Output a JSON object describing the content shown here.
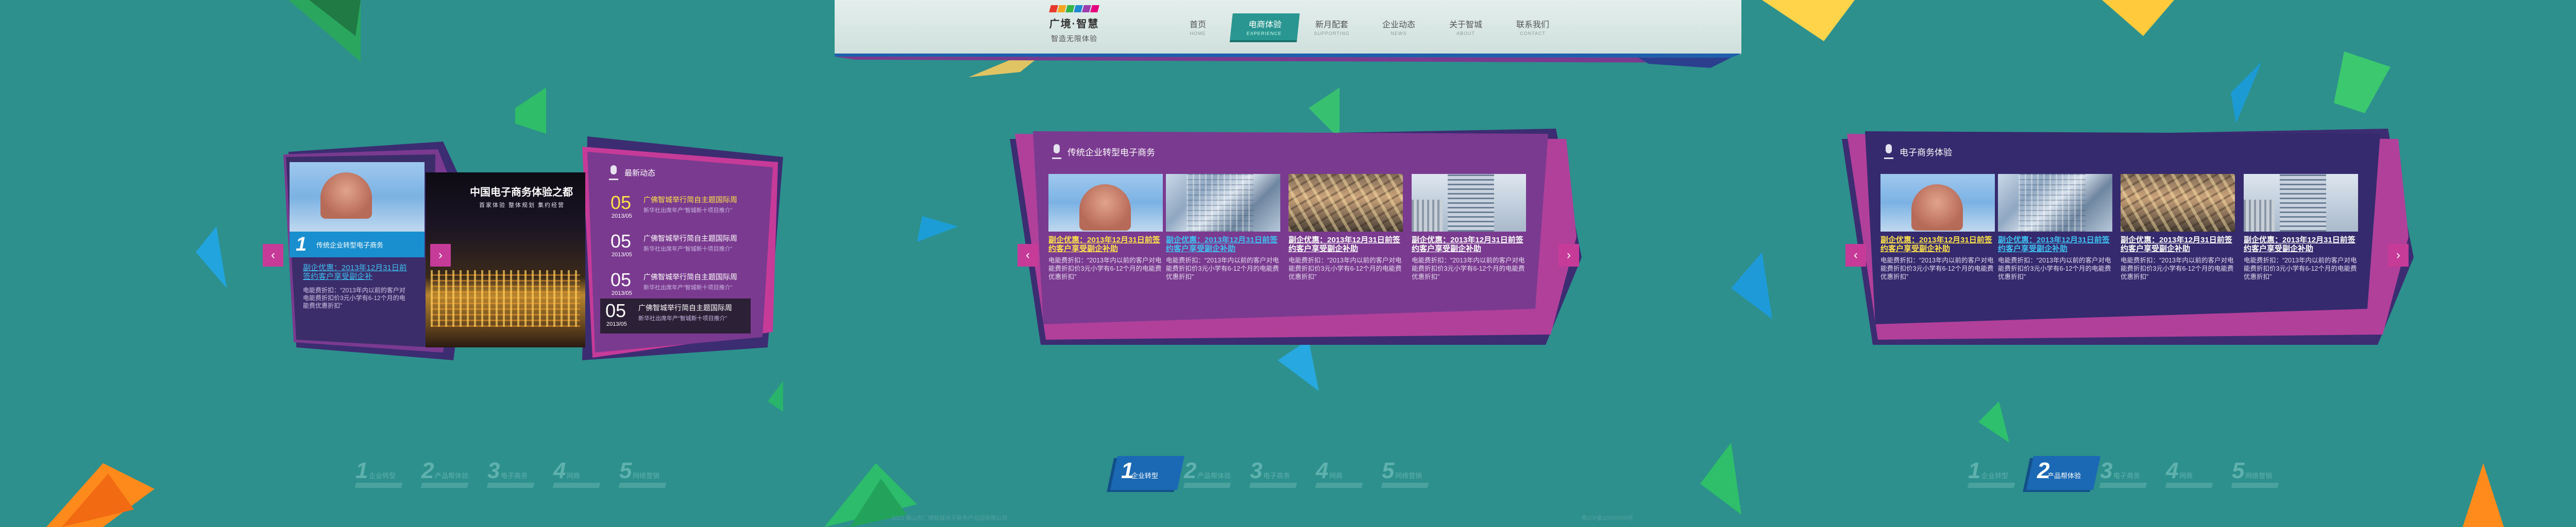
{
  "colors": {
    "background": "#2e908c",
    "purple": "#7a3a8f",
    "purple_dark": "#3a2d6a",
    "magenta": "#c63b98",
    "nav_active": "#2a9691",
    "step_active": "#1b69b4",
    "highlight_text": "#ffe24a"
  },
  "header": {
    "logo_title": "广境·智慧",
    "logo_sub": "智造无限体验",
    "nav": [
      {
        "zh": "首页",
        "en": "HOME"
      },
      {
        "zh": "电商体验",
        "en": "EXPERIENCE"
      },
      {
        "zh": "新月配套",
        "en": "SUPPORTING"
      },
      {
        "zh": "企业动态",
        "en": "NEWS"
      },
      {
        "zh": "关于智城",
        "en": "ABOUT"
      },
      {
        "zh": "联系我们",
        "en": "CONTACT"
      }
    ],
    "active_nav": 1
  },
  "left_panel": {
    "feature_number": "1",
    "feature_label": "传统企业转型电子商务",
    "feature_link": "副企优惠：2013年12月31日前签约客户享受副企补",
    "feature_text": "电能费折扣：“2013年内以前的客户对电能费折扣价3元小学有6-12个月的电能费优惠折扣”",
    "big_title": "中国电子商务体验之都",
    "big_sub": "首家体验 整体规划 集约经营",
    "news_heading": "最新动态",
    "news": [
      {
        "day": "05",
        "ym": "2013/05",
        "title": "广佛智城举行简自主题国际周",
        "sub": "新华社出席年产“智城新十项目推介”"
      },
      {
        "day": "05",
        "ym": "2013/05",
        "title": "广佛智城举行简自主题国际周",
        "sub": "新华社出席年产“智城新十项目推介”"
      },
      {
        "day": "05",
        "ym": "2013/05",
        "title": "广佛智城举行简自主题国际周",
        "sub": "新华社出席年产“智城新十项目推介”"
      },
      {
        "day": "05",
        "ym": "2013/05",
        "title": "广佛智城举行简自主题国际周",
        "sub": "新华社出席年产“智城新十项目推介”"
      }
    ]
  },
  "middle_panel": {
    "title": "传统企业转型电子商务",
    "cards": [
      {
        "title": "副企优惠：2013年12月31日前签约客户享受副企补助",
        "body": "电能费折扣：“2013年内以前的客户对电能费折扣价3元小学有6-12个月的电能费优惠折扣”"
      },
      {
        "title": "副企优惠：2013年12月31日前签约客户享受副企补助",
        "body": "电能费折扣：“2013年内以前的客户对电能费折扣价3元小学有6-12个月的电能费优惠折扣”"
      },
      {
        "title": "副企优惠：2013年12月31日前签约客户享受副企补助",
        "body": "电能费折扣：“2013年内以前的客户对电能费折扣价3元小学有6-12个月的电能费优惠折扣”"
      },
      {
        "title": "副企优惠：2013年12月31日前签约客户享受副企补助",
        "body": "电能费折扣：“2013年内以前的客户对电能费折扣价3元小学有6-12个月的电能费优惠折扣”"
      }
    ]
  },
  "right_panel": {
    "title": "电子商务体验",
    "cards": [
      {
        "title": "副企优惠：2013年12月31日前签约客户享受副企补助",
        "body": "电能费折扣：“2013年内以前的客户对电能费折扣价3元小学有6-12个月的电能费优惠折扣”"
      },
      {
        "title": "副企优惠：2013年12月31日前签约客户享受副企补助",
        "body": "电能费折扣：“2013年内以前的客户对电能费折扣价3元小学有6-12个月的电能费优惠折扣”"
      },
      {
        "title": "副企优惠：2013年12月31日前签约客户享受副企补助",
        "body": "电能费折扣：“2013年内以前的客户对电能费折扣价3元小学有6-12个月的电能费优惠折扣”"
      },
      {
        "title": "副企优惠：2013年12月31日前签约客户享受副企补助",
        "body": "电能费折扣：“2013年内以前的客户对电能费折扣价3元小学有6-12个月的电能费优惠折扣”"
      }
    ]
  },
  "steps": [
    {
      "num": "1",
      "label": "企业转型"
    },
    {
      "num": "2",
      "label": "产品帮体验"
    },
    {
      "num": "3",
      "label": "电子商务"
    },
    {
      "num": "4",
      "label": "网商"
    },
    {
      "num": "5",
      "label": "网络营销"
    }
  ],
  "arrows": {
    "prev": "‹",
    "next": "›"
  },
  "footer": {
    "copyright": "2013 佛山市广佛智城电子商务产业园有限公司",
    "icp": "粤ICP备10089999号"
  }
}
